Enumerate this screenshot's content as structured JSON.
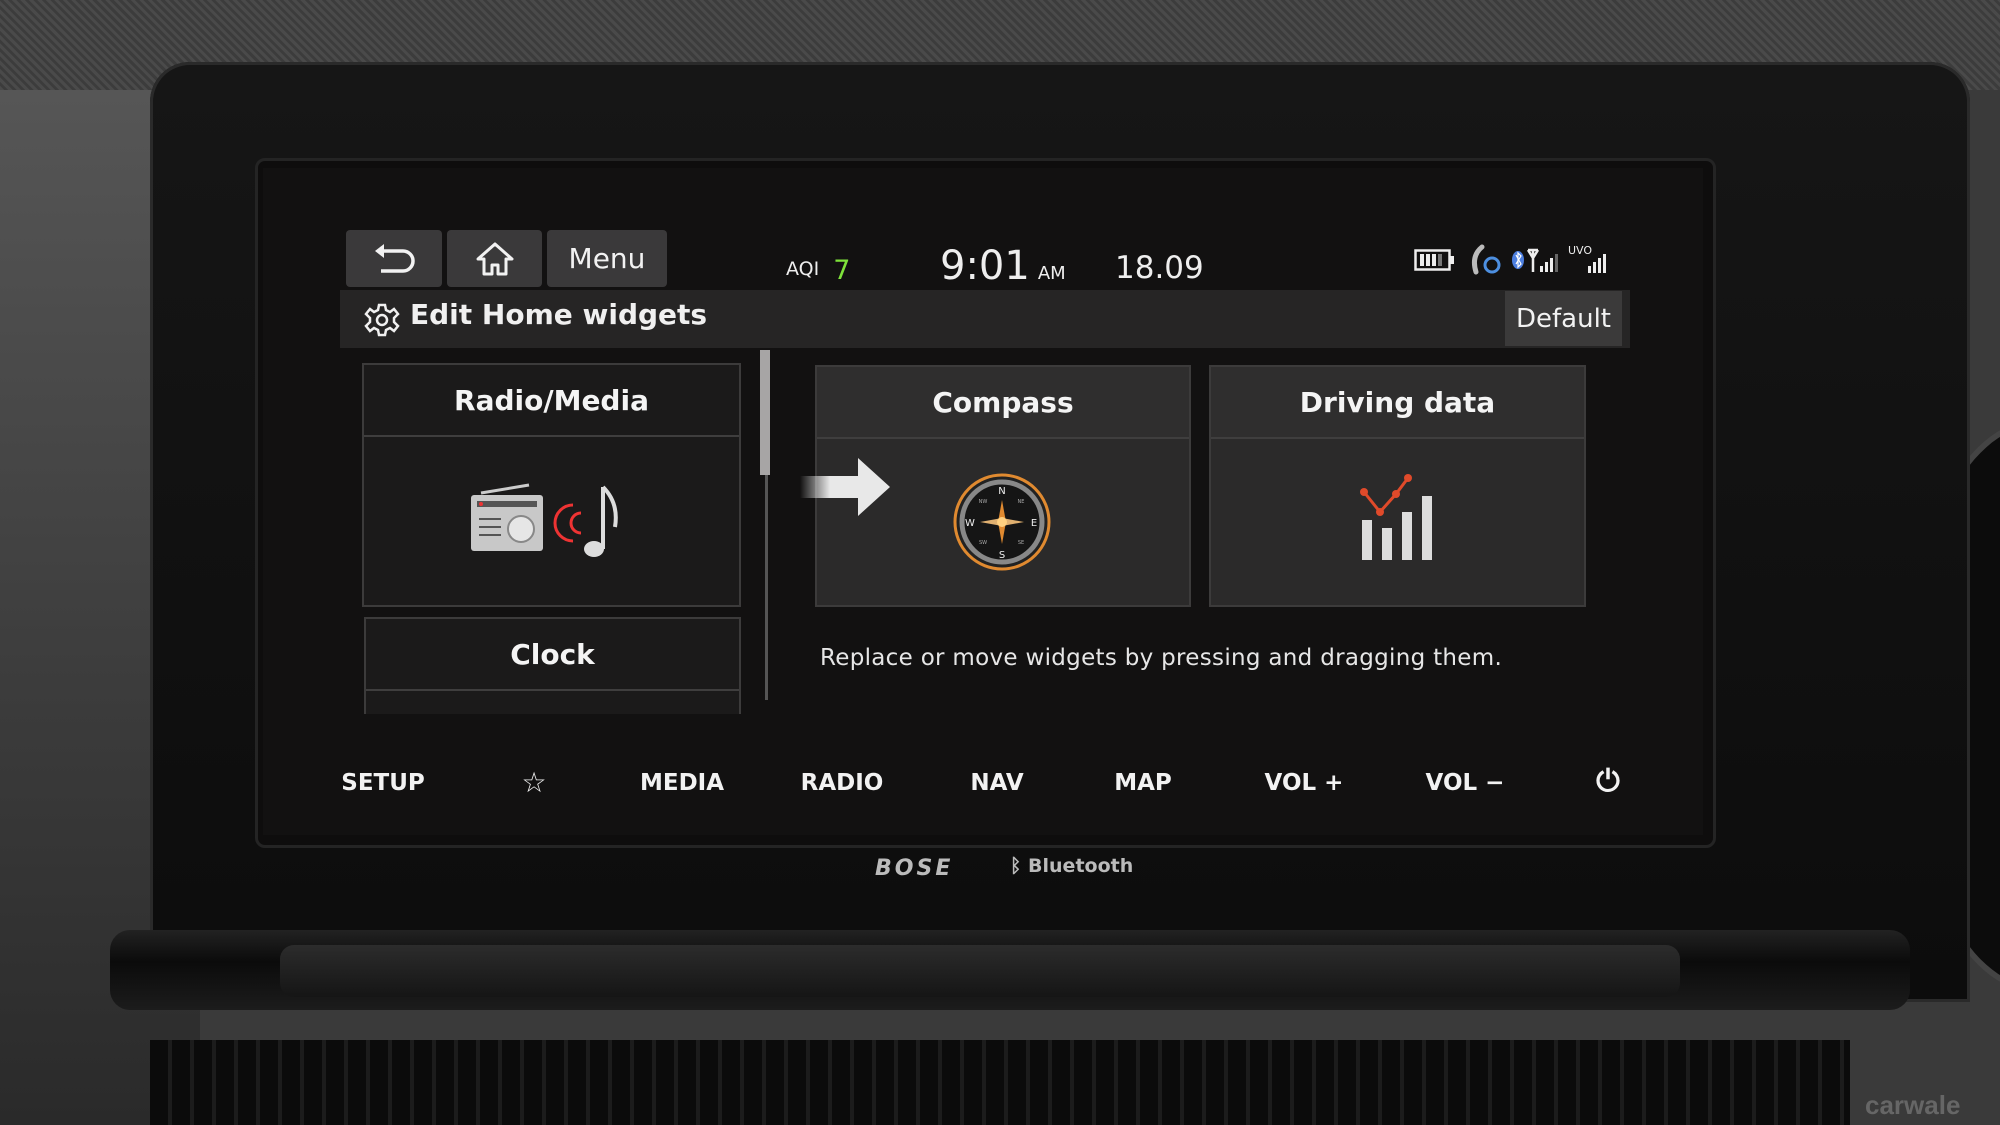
{
  "top_bar": {
    "back_icon": "back-arrow-icon",
    "home_icon": "home-icon",
    "menu_label": "Menu"
  },
  "status": {
    "aqi_label": "AQI",
    "aqi_value": "7",
    "aqi_color": "#7ee23a",
    "time": "9:01",
    "ampm": "AM",
    "date": "18.09",
    "icons": [
      "battery-icon",
      "phone-sync-icon",
      "bluetooth-icon",
      "signal-icon",
      "uvo-signal-icon"
    ],
    "uvo_label": "UVO"
  },
  "edit_bar": {
    "title": "Edit Home widgets",
    "default_label": "Default"
  },
  "widgets": {
    "left": [
      {
        "title": "Radio/Media",
        "icon": "radio-music-icon"
      },
      {
        "title": "Clock",
        "icon": "clock-icon"
      }
    ],
    "right": [
      {
        "title": "Compass",
        "icon": "compass-icon"
      },
      {
        "title": "Driving data",
        "icon": "driving-data-chart-icon"
      }
    ],
    "compass_letters": {
      "n": "N",
      "s": "S",
      "e": "E",
      "w": "W",
      "ne": "NE",
      "nw": "NW",
      "se": "SE",
      "sw": "SW"
    }
  },
  "hint": "Replace or move widgets by pressing and dragging them.",
  "bottom_nav": [
    {
      "label": "SETUP"
    },
    {
      "label": "☆",
      "icon": "star-icon"
    },
    {
      "label": "MEDIA"
    },
    {
      "label": "RADIO"
    },
    {
      "label": "NAV"
    },
    {
      "label": "MAP"
    },
    {
      "label": "VOL +"
    },
    {
      "label": "VOL −"
    },
    {
      "label": "⏻",
      "icon": "power-icon"
    }
  ],
  "branding": {
    "audio": "BOSE",
    "bluetooth": "Bluetooth"
  },
  "watermark": "carwale"
}
